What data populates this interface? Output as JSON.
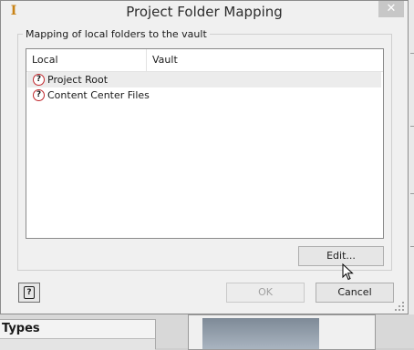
{
  "dialog": {
    "title": "Project Folder Mapping",
    "close_glyph": "✕",
    "app_icon": "inventor-app-icon",
    "group_label": "Mapping of local folders to the vault",
    "columns": {
      "local": "Local",
      "vault": "Vault"
    },
    "rows": [
      {
        "local": "Project Root",
        "vault": "",
        "icon": "question-mark-icon"
      },
      {
        "local": "Content Center Files",
        "vault": "",
        "icon": "question-mark-icon"
      }
    ],
    "buttons": {
      "edit": "Edit...",
      "ok": "OK",
      "cancel": "Cancel",
      "help_icon": "help-icon"
    }
  },
  "background": {
    "types_header": "Types"
  },
  "colors": {
    "dialog_bg": "#f0f0f0",
    "close_button": "#c7c7c7",
    "question_icon_ring": "#c0282d",
    "app_icon": "#c98316"
  }
}
